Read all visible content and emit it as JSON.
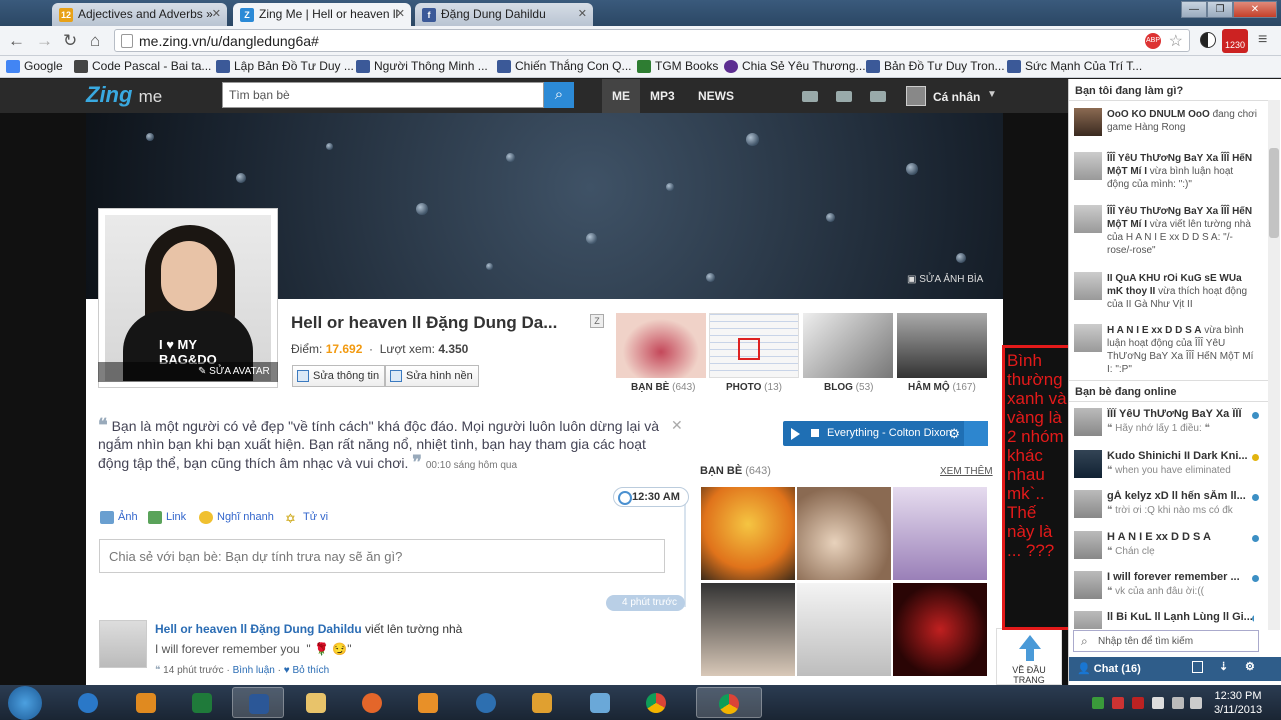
{
  "browser": {
    "tabs": [
      {
        "label": "Adjectives and Adverbs »"
      },
      {
        "label": "Zing Me | Hell or heaven ll"
      },
      {
        "label": "Đặng Dung Dahildu"
      }
    ],
    "url": "me.zing.vn/u/dangledung6a#",
    "badge": "1230",
    "bookmarks": [
      {
        "label": "Google"
      },
      {
        "label": "Code Pascal - Bai ta..."
      },
      {
        "label": "Lập Bản Đồ Tư Duy ..."
      },
      {
        "label": "Người Thông Minh ..."
      },
      {
        "label": "Chiến Thắng Con Q..."
      },
      {
        "label": "TGM Books"
      },
      {
        "label": "Chia Sẻ Yêu Thương..."
      },
      {
        "label": "Bản Đồ Tư Duy Tron..."
      },
      {
        "label": "Sức Mạnh Của Trí T..."
      }
    ]
  },
  "zing": {
    "logo": "Zing",
    "logo_suffix": "me",
    "search_placeholder": "Tìm bạn bè",
    "nav": [
      {
        "label": "ME"
      },
      {
        "label": "MP3"
      },
      {
        "label": "NEWS"
      }
    ],
    "account": "Cá nhân"
  },
  "profile": {
    "cover_edit": "SỬA ẢNH BÌA",
    "avatar_edit": "SỬA AVATAR",
    "avatar_shirt_text": "I ♥ MY BAG&DO",
    "name": "Hell or heaven ll Đặng Dung Da...",
    "points_label": "Điểm:",
    "points": "17.692",
    "views_label": "Lượt xem:",
    "views": "4.350",
    "edit_info": "Sửa thông tin",
    "edit_wallpaper": "Sửa hình nền",
    "thumbs": [
      {
        "label": "BẠN BÈ",
        "count": "(643)"
      },
      {
        "label": "PHOTO",
        "count": "(13)"
      },
      {
        "label": "BLOG",
        "count": "(53)"
      },
      {
        "label": "HÂM MỘ",
        "count": "(167)"
      }
    ]
  },
  "feed": {
    "quote": "Bạn là một người có vẻ đẹp \"về tính cách\" khá độc đáo. Mọi người luôn luôn dừng lại và ngắm nhìn bạn khi bạn xuất hiện. Bạn rất năng nổ, nhiệt tình, bạn hay tham gia các hoạt động tập thể, bạn cũng thích âm nhạc và vui chơi.",
    "quote_time": "00:10 sáng hôm qua",
    "time_pill": "12:30 AM",
    "share_types": [
      {
        "label": "Ảnh"
      },
      {
        "label": "Link"
      },
      {
        "label": "Nghĩ nhanh"
      },
      {
        "label": "Tử vi"
      }
    ],
    "share_placeholder": "Chia sẻ với bạn bè:  Bạn dự tính trưa nay sẽ ăn gì?",
    "ago_pill": "4 phút trước",
    "post": {
      "author": "Hell or heaven ll Đặng Dung Dahildu",
      "action": "viết lên tường nhà",
      "text": "I will forever remember you",
      "quote_marks": "\"",
      "emoji": "🌹 😏",
      "time": "14 phút trước",
      "comment": "Bình luận",
      "like": "Bỏ thích"
    }
  },
  "music": {
    "track": "Everything - Colton Dixon"
  },
  "friends_box": {
    "label": "BẠN BÈ",
    "count": "(643)",
    "more": "XEM THÊM"
  },
  "to_top": "VỀ ĐẦU TRANG",
  "annotation": "Bình thường xanh và vàng là 2 nhóm khác nhau mk`.. Thế này là ... ???",
  "sidebar": {
    "activity_title": "Bạn tôi đang làm gì?",
    "activities": [
      {
        "name": "OoO KO DNULM OoO",
        "text": "đang chơi game Hàng Rong"
      },
      {
        "name": "ÎÎÎ YêU ThƯơNg BaY Xa ÎÎÎ HếN MộT Mí I",
        "text": "vừa bình luận hoạt động của mình: \":)\""
      },
      {
        "name": "ÎÎÎ YêU ThƯơNg BaY Xa ÎÎÎ HếN MộT Mí I",
        "text": "vừa viết lên tường nhà của H A N I E xx D D S A: \"/-rose/-rose\""
      },
      {
        "name": "II QuA KHU rOi KuG sE WUa mK thoy II",
        "text": "vừa thích hoạt động của II Gà Như Vịt II"
      },
      {
        "name": "H A N I E xx D D S A",
        "text": "vừa bình luận hoạt động của ÎÎÎ YêU ThƯơNg BaY Xa ÎÎÎ HếN MộT Mí I: \":P\""
      }
    ],
    "online_title": "Bạn bè đang online",
    "online": [
      {
        "name": "ÎÎÎ YêU ThƯơNg BaY Xa ÎÎÎ",
        "status": "❝ Hãy nhớ lấy 1 điều: ❝",
        "state": "online"
      },
      {
        "name": "Kudo Shinichi II Dark Kni...",
        "status": "❝ when you have eliminated",
        "state": "idle"
      },
      {
        "name": "gÀ kelyz xD ll hến sẦm ll...",
        "status": "❝ trời ơi :Q khi nào ms có đk",
        "state": "online"
      },
      {
        "name": "H A N I E xx D D S A",
        "status": "❝ Chán clẹ",
        "state": "online"
      },
      {
        "name": "I will forever remember ...",
        "status": "❝ vk của anh đâu ời:((",
        "state": "online"
      },
      {
        "name": "ll Bi KuL ll Lạnh Lùng ll Gi...",
        "status": "",
        "state": "online"
      }
    ],
    "search_placeholder": "Nhập tên để tìm kiếm",
    "chat_label": "Chat (16)"
  },
  "taskbar": {
    "time": "12:30 PM",
    "date": "3/11/2013"
  },
  "colors": {
    "zing_blue": "#39a9e0",
    "accent": "#2c8ad6",
    "annotation": "#e41a1a",
    "online_dot": "#3c8fc4",
    "idle_dot": "#e2b40f"
  }
}
